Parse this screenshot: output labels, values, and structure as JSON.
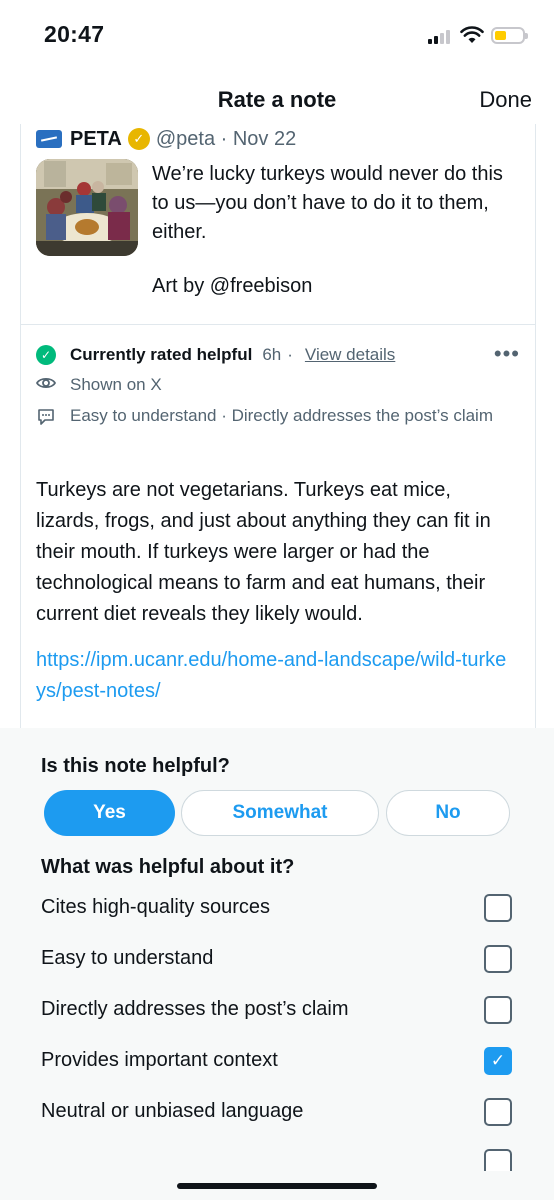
{
  "status_bar": {
    "time": "20:47"
  },
  "header": {
    "title": "Rate a note",
    "done_label": "Done"
  },
  "tweet": {
    "author": "PETA",
    "handle_date": "@peta · Nov 22",
    "text": "We’re lucky turkeys would never do this to us—you don’t have to do it to them, either.",
    "art_credit": "Art by @freebison"
  },
  "note": {
    "status_label": "Currently rated helpful",
    "status_time": "6h",
    "separator": "·",
    "view_details": "View details",
    "shown_on": "Shown on X",
    "tags": "Easy to understand · Directly addresses the post’s claim",
    "body": "Turkeys are not vegetarians. Turkeys eat mice, lizards, frogs, and just about anything they can fit in their mouth. If turkeys were larger or had the technological means to farm and eat humans, their current diet reveals they likely would.",
    "link": "https://ipm.ucanr.edu/home-and-landscape/wild-turkeys/pest-notes/"
  },
  "rating": {
    "question": "Is this note helpful?",
    "options": [
      "Yes",
      "Somewhat",
      "No"
    ],
    "selected": "Yes",
    "followup": "What was helpful about it?",
    "reasons": [
      {
        "label": "Cites high-quality sources",
        "checked": false
      },
      {
        "label": "Easy to understand",
        "checked": false
      },
      {
        "label": "Directly addresses the post’s claim",
        "checked": false
      },
      {
        "label": "Provides important context",
        "checked": true
      },
      {
        "label": "Neutral or unbiased language",
        "checked": false
      }
    ]
  },
  "colors": {
    "accent": "#1d9bf0",
    "helpful_green": "#00ba7c",
    "verified_gold": "#e8b600",
    "battery_yellow": "#ffcc00"
  },
  "icons": [
    "signal-icon",
    "wifi-icon",
    "battery-icon",
    "peta-logo-icon",
    "verified-badge-icon",
    "check-circle-icon",
    "eye-icon",
    "comment-icon",
    "more-icon",
    "checkmark-icon"
  ]
}
